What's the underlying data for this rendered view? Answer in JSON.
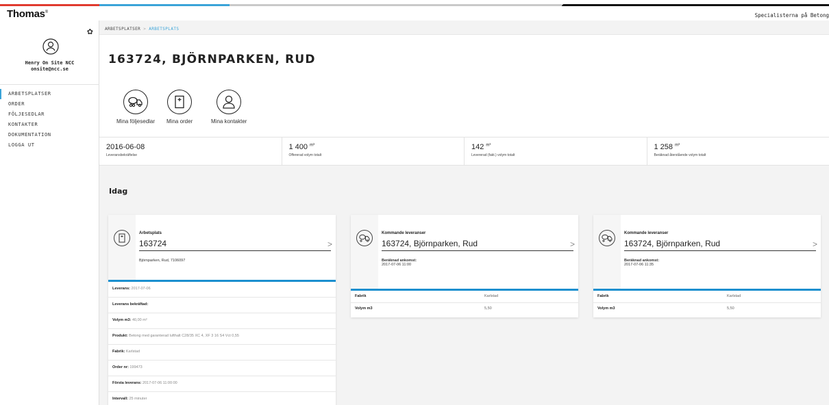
{
  "app": {
    "logo": "Thomas",
    "tagline": "Specialisterna på Betong"
  },
  "user": {
    "name": "Henry On Site NCC",
    "email": "onsite@ncc.se"
  },
  "sidebar": {
    "items": [
      {
        "label": "ARBETSPLATSER"
      },
      {
        "label": "ORDER"
      },
      {
        "label": "FÖLJESEDLAR"
      },
      {
        "label": "KONTAKTER"
      },
      {
        "label": "DOKUMENTATION"
      },
      {
        "label": "LOGGA UT"
      }
    ]
  },
  "breadcrumb": {
    "parent": "ARBETSPLATSER",
    "sep": ">",
    "current": "ARBETSPLATS"
  },
  "page": {
    "title": "163724, BJÖRNPARKEN, RUD"
  },
  "quick": [
    {
      "label": "Mina följesedlar"
    },
    {
      "label": "Mina order"
    },
    {
      "label": "Mina kontakter"
    }
  ],
  "stats": [
    {
      "value": "2016-06-08",
      "unit": "",
      "label": "Leveransbekräftelse"
    },
    {
      "value": "1 400",
      "unit": "m³",
      "label": "Offererad volym totalt"
    },
    {
      "value": "142",
      "unit": "m³",
      "label": "Levererad (fakt.) volym totalt"
    },
    {
      "value": "1 258",
      "unit": "m³",
      "label": "Beräknad återstående volym totalt"
    }
  ],
  "section": {
    "title": "Idag"
  },
  "card1": {
    "small": "Arbetsplats",
    "big": "163724",
    "sub": "Björnparken, Rud, 7106097",
    "rows": [
      {
        "label": "Leverans:",
        "value": "2017-07-06"
      },
      {
        "label": "Leverans bekräftad:",
        "value": ""
      },
      {
        "label": "Volym m3:",
        "value": "40,00 m³"
      },
      {
        "label": "Produkt:",
        "value": "Betong med garanterad lufthalt C28/35 XC 4, XF 3 16 S4 Vct 0,55"
      },
      {
        "label": "Fabrik:",
        "value": "Karlstad"
      },
      {
        "label": "Order nr:",
        "value": "199473"
      },
      {
        "label": "Första leverans:",
        "value": "2017-07-06 11:00:00"
      },
      {
        "label": "Intervall:",
        "value": "25 minuter"
      }
    ]
  },
  "card2": {
    "small": "Kommande leveranser",
    "big": "163724, Björnparken, Rud",
    "sub_label": "Beräknad ankomst:",
    "sub_value": "2017-07-06 11:00",
    "rows": [
      {
        "label": "Fabrik",
        "value": "Karlstad"
      },
      {
        "label": "Volym m3",
        "value": "5,50"
      }
    ]
  },
  "card3": {
    "small": "Kommande leveranser",
    "big": "163724, Björnparken, Rud",
    "sub_label": "Beräknad ankomst:",
    "sub_value": "2017-07-06 11:35",
    "rows": [
      {
        "label": "Fabrik",
        "value": "Karlstad"
      },
      {
        "label": "Volym m3",
        "value": "5,50"
      }
    ]
  }
}
